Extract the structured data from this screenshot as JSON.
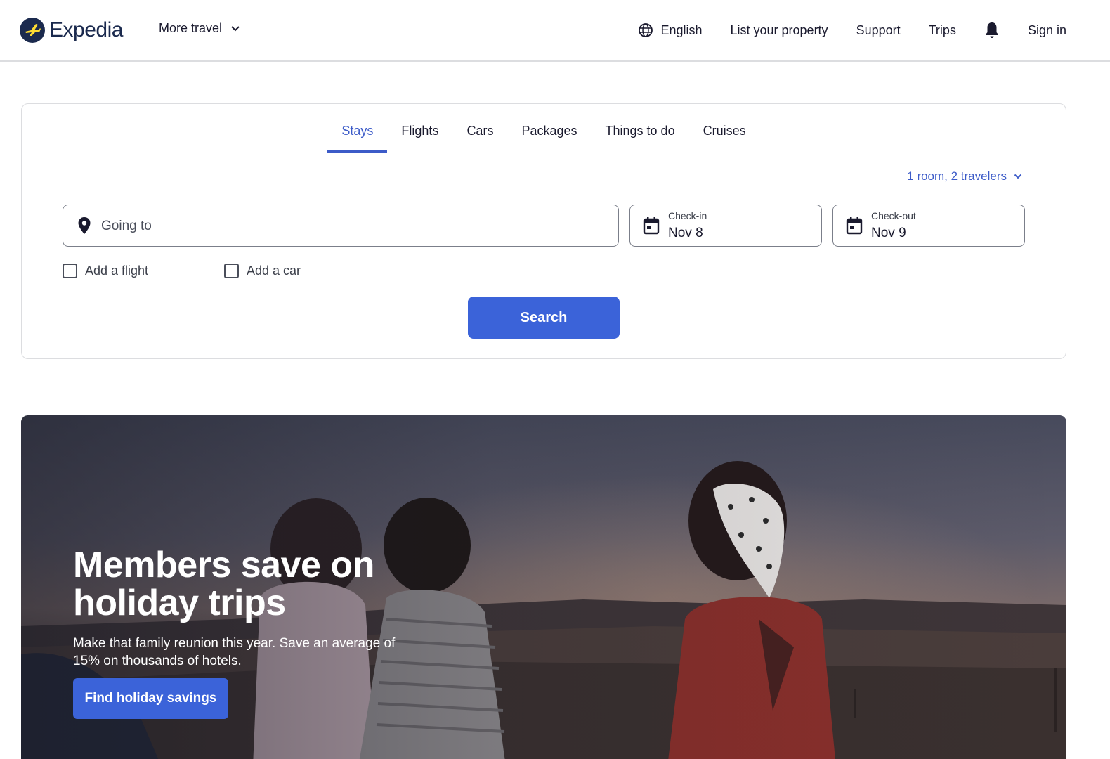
{
  "header": {
    "brand": "Expedia",
    "more_travel": "More travel",
    "nav": {
      "language": "English",
      "list_property": "List your property",
      "support": "Support",
      "trips": "Trips",
      "sign_in": "Sign in"
    }
  },
  "search": {
    "tabs": [
      {
        "label": "Stays",
        "active": true
      },
      {
        "label": "Flights",
        "active": false
      },
      {
        "label": "Cars",
        "active": false
      },
      {
        "label": "Packages",
        "active": false
      },
      {
        "label": "Things to do",
        "active": false
      },
      {
        "label": "Cruises",
        "active": false
      }
    ],
    "travelers": "1 room, 2 travelers",
    "destination_placeholder": "Going to",
    "check_in": {
      "label": "Check-in",
      "value": "Nov 8"
    },
    "check_out": {
      "label": "Check-out",
      "value": "Nov 9"
    },
    "add_flight": "Add a flight",
    "add_car": "Add a car",
    "search_button": "Search"
  },
  "hero": {
    "title": "Members save on holiday trips",
    "subtitle": "Make that family reunion this year. Save an average of 15% on thousands of hotels.",
    "cta": "Find holiday savings"
  },
  "colors": {
    "accent": "#3b63d9",
    "link": "#3c5bc8",
    "brand_navy": "#1b2a4e",
    "brand_yellow": "#fddb32"
  },
  "icons": [
    "expedia-logo-icon",
    "chevron-down-icon",
    "globe-icon",
    "bell-icon",
    "map-pin-icon",
    "calendar-icon"
  ]
}
